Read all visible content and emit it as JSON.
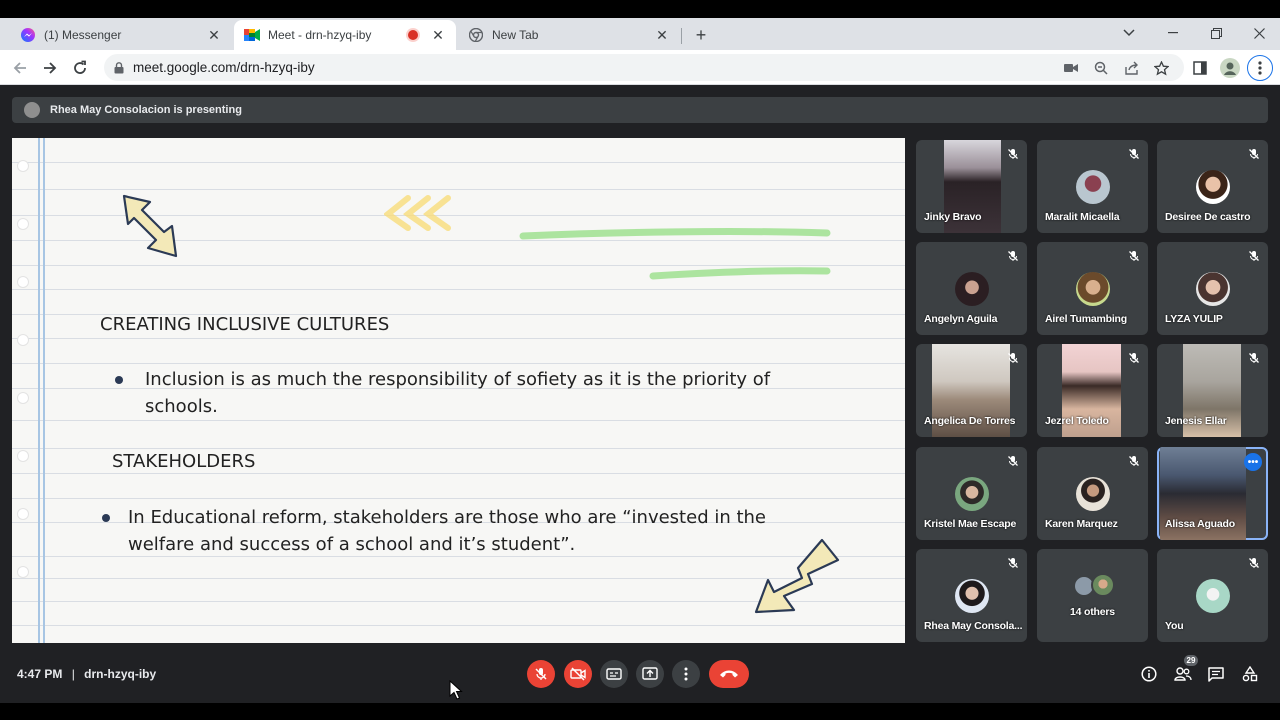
{
  "browser": {
    "tabs": [
      {
        "title": "(1) Messenger",
        "favicon": "messenger-icon",
        "active": false
      },
      {
        "title": "Meet - drn-hzyq-iby",
        "favicon": "meet-icon",
        "active": true,
        "recording": true
      },
      {
        "title": "New Tab",
        "favicon": "chrome-icon",
        "active": false
      }
    ],
    "url": "meet.google.com/drn-hzyq-iby"
  },
  "meet": {
    "presenting_label": "Rhea May Consolacion is presenting",
    "slide": {
      "heading1": "CREATING INCLUSIVE CULTURES",
      "bullet1_line1": "Inclusion is as much the responsibility of sofiety as it is the priority of",
      "bullet1_line2": "schools.",
      "heading2": "STAKEHOLDERS",
      "bullet2_line1": "In Educational reform, stakeholders are those who are “invested in the",
      "bullet2_line2": "welfare and success of a school and it’s student”."
    },
    "participants": [
      {
        "name": "Jinky Bravo"
      },
      {
        "name": "Maralit Micaella"
      },
      {
        "name": "Desiree De castro"
      },
      {
        "name": "Angelyn Aguila"
      },
      {
        "name": "Airel Tumambing"
      },
      {
        "name": "LYZA YULIP"
      },
      {
        "name": "Angelica De Torres"
      },
      {
        "name": "Jezrel Toledo"
      },
      {
        "name": "Jenesis Ellar"
      },
      {
        "name": "Kristel Mae Escape"
      },
      {
        "name": "Karen Marquez"
      },
      {
        "name": "Alissa Aguado"
      },
      {
        "name": "Rhea May Consola..."
      },
      {
        "name": "14 others"
      },
      {
        "name": "You"
      }
    ],
    "bottom": {
      "time": "4:47 PM",
      "separator": "|",
      "meeting_code": "drn-hzyq-iby",
      "people_count": "29"
    }
  },
  "colors": {
    "meet_bg": "#202124",
    "tile_bg": "#3c4043",
    "danger_red": "#ea4335",
    "accent_blue": "#1a73e8"
  }
}
